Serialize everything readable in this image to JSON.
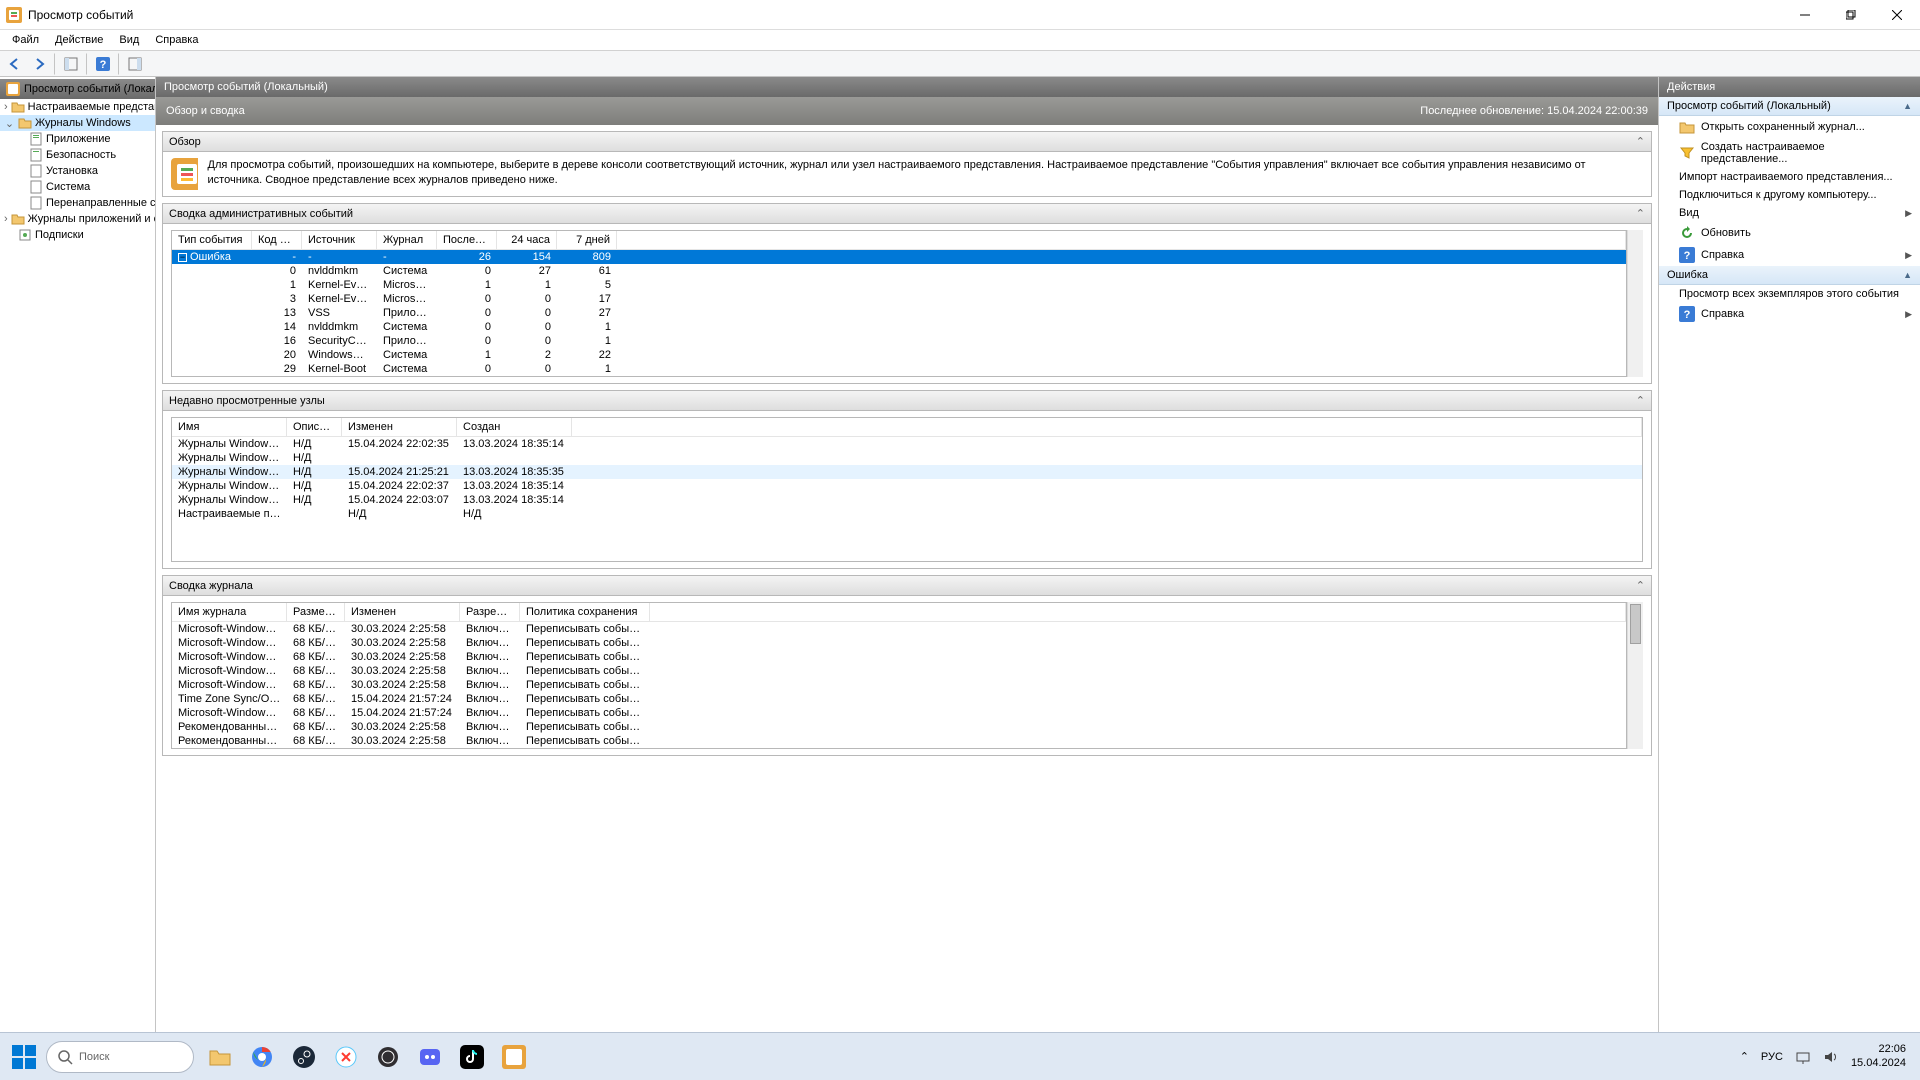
{
  "window": {
    "title": "Просмотр событий"
  },
  "menu": {
    "file": "Файл",
    "action": "Действие",
    "view": "Вид",
    "help": "Справка"
  },
  "tree": {
    "header": "Просмотр событий (Локальн",
    "custom": "Настраиваемые представл",
    "winlogs": "Журналы Windows",
    "app": "Приложение",
    "sec": "Безопасность",
    "setup": "Установка",
    "sys": "Система",
    "fwd": "Перенаправленные соб",
    "appsvc": "Журналы приложений и сл",
    "subs": "Подписки"
  },
  "center": {
    "title": "Просмотр событий (Локальный)",
    "summary": "Обзор и сводка",
    "lastupdate": "Последнее обновление: 15.04.2024 22:00:39"
  },
  "overview": {
    "header": "Обзор",
    "text": "Для просмотра событий, произошедших на компьютере, выберите в дереве консоли соответствующий источник, журнал или узел настраиваемого представления. Настраиваемое представление \"События управления\" включает все события управления независимо от источника. Сводное представление всех журналов приведено ниже."
  },
  "admin": {
    "header": "Сводка административных событий",
    "cols": {
      "type": "Тип события",
      "code": "Код соб...",
      "src": "Источник",
      "log": "Журнал",
      "last": "Последн...",
      "h24": "24 часа",
      "d7": "7 дней"
    },
    "rows": [
      {
        "type": "Ошибка",
        "code": "-",
        "src": "-",
        "log": "-",
        "last": "26",
        "h24": "154",
        "d7": "809",
        "sel": true,
        "exp": true
      },
      {
        "type": "",
        "code": "0",
        "src": "nvlddmkm",
        "log": "Система",
        "last": "0",
        "h24": "27",
        "d7": "61"
      },
      {
        "type": "",
        "code": "1",
        "src": "Kernel-EventTr...",
        "log": "Microsoft...",
        "last": "1",
        "h24": "1",
        "d7": "5"
      },
      {
        "type": "",
        "code": "3",
        "src": "Kernel-EventTr...",
        "log": "Microsoft...",
        "last": "0",
        "h24": "0",
        "d7": "17"
      },
      {
        "type": "",
        "code": "13",
        "src": "VSS",
        "log": "Приложе...",
        "last": "0",
        "h24": "0",
        "d7": "27"
      },
      {
        "type": "",
        "code": "14",
        "src": "nvlddmkm",
        "log": "Система",
        "last": "0",
        "h24": "0",
        "d7": "1"
      },
      {
        "type": "",
        "code": "16",
        "src": "SecurityCenter",
        "log": "Приложе...",
        "last": "0",
        "h24": "0",
        "d7": "1"
      },
      {
        "type": "",
        "code": "20",
        "src": "WindowsUpda...",
        "log": "Система",
        "last": "1",
        "h24": "2",
        "d7": "22"
      },
      {
        "type": "",
        "code": "29",
        "src": "Kernel-Boot",
        "log": "Система",
        "last": "0",
        "h24": "0",
        "d7": "1"
      }
    ]
  },
  "recent": {
    "header": "Недавно просмотренные узлы",
    "cols": {
      "name": "Имя",
      "desc": "Описание",
      "mod": "Изменен",
      "created": "Создан"
    },
    "rows": [
      {
        "name": "Журналы Windows\\Сис...",
        "desc": "Н/Д",
        "mod": "15.04.2024 22:02:35",
        "created": "13.03.2024 18:35:14"
      },
      {
        "name": "Журналы Windows\\Пер...",
        "desc": "Н/Д",
        "mod": "",
        "created": ""
      },
      {
        "name": "Журналы Windows\\Уст...",
        "desc": "Н/Д",
        "mod": "15.04.2024 21:25:21",
        "created": "13.03.2024 18:35:35",
        "hov": true
      },
      {
        "name": "Журналы Windows\\Без...",
        "desc": "Н/Д",
        "mod": "15.04.2024 22:02:37",
        "created": "13.03.2024 18:35:14"
      },
      {
        "name": "Журналы Windows\\Пр...",
        "desc": "Н/Д",
        "mod": "15.04.2024 22:03:07",
        "created": "13.03.2024 18:35:14"
      },
      {
        "name": "Настраиваемые предст...",
        "desc": "",
        "mod": "Н/Д",
        "created": "Н/Д"
      }
    ]
  },
  "logsum": {
    "header": "Сводка журнала",
    "cols": {
      "name": "Имя журнала",
      "size": "Размер (...",
      "mod": "Изменен",
      "en": "Разрешено",
      "pol": "Политика сохранения"
    },
    "rows": [
      {
        "name": "Microsoft-Windows-User...",
        "size": "68 КБ/1,0...",
        "mod": "30.03.2024 2:25:58",
        "en": "Включено",
        "pol": "Переписывать событи..."
      },
      {
        "name": "Microsoft-Windows-Uni...",
        "size": "68 КБ/1,0...",
        "mod": "30.03.2024 2:25:58",
        "en": "Включено",
        "pol": "Переписывать событи..."
      },
      {
        "name": "Microsoft-Windows-UAC...",
        "size": "68 КБ/1,0...",
        "mod": "30.03.2024 2:25:58",
        "en": "Включено",
        "pol": "Переписывать событи..."
      },
      {
        "name": "Microsoft-Windows-UAC...",
        "size": "68 КБ/1,0...",
        "mod": "30.03.2024 2:25:58",
        "en": "Включено",
        "pol": "Переписывать событи..."
      },
      {
        "name": "Microsoft-Windows-TZU...",
        "size": "68 КБ/1,0...",
        "mod": "30.03.2024 2:25:58",
        "en": "Включено",
        "pol": "Переписывать событи..."
      },
      {
        "name": "Time Zone Sync/Операц...",
        "size": "68 КБ/1,0...",
        "mod": "15.04.2024 21:57:24",
        "en": "Включено",
        "pol": "Переписывать событи..."
      },
      {
        "name": "Microsoft-Windows-TWi...",
        "size": "68 КБ/1,0...",
        "mod": "15.04.2024 21:57:24",
        "en": "Включено",
        "pol": "Переписывать событи..."
      },
      {
        "name": "Рекомендованные спос...",
        "size": "68 КБ/1,0...",
        "mod": "30.03.2024 2:25:58",
        "en": "Включено",
        "pol": "Переписывать событи..."
      },
      {
        "name": "Рекомендованные спос...",
        "size": "68 КБ/1,0...",
        "mod": "30.03.2024 2:25:58",
        "en": "Включено",
        "pol": "Переписывать событи..."
      }
    ]
  },
  "actions": {
    "title": "Действия",
    "group1": "Просмотр событий (Локальный)",
    "open": "Открыть сохраненный журнал...",
    "create": "Создать настраиваемое представление...",
    "import": "Импорт настраиваемого представления...",
    "connect": "Подключиться к другому компьютеру...",
    "view": "Вид",
    "refresh": "Обновить",
    "help": "Справка",
    "group2": "Ошибка",
    "viewall": "Просмотр всех экземпляров этого события",
    "help2": "Справка"
  },
  "taskbar": {
    "search": "Поиск",
    "lang": "РУС",
    "time": "22:06",
    "date": "15.04.2024"
  }
}
